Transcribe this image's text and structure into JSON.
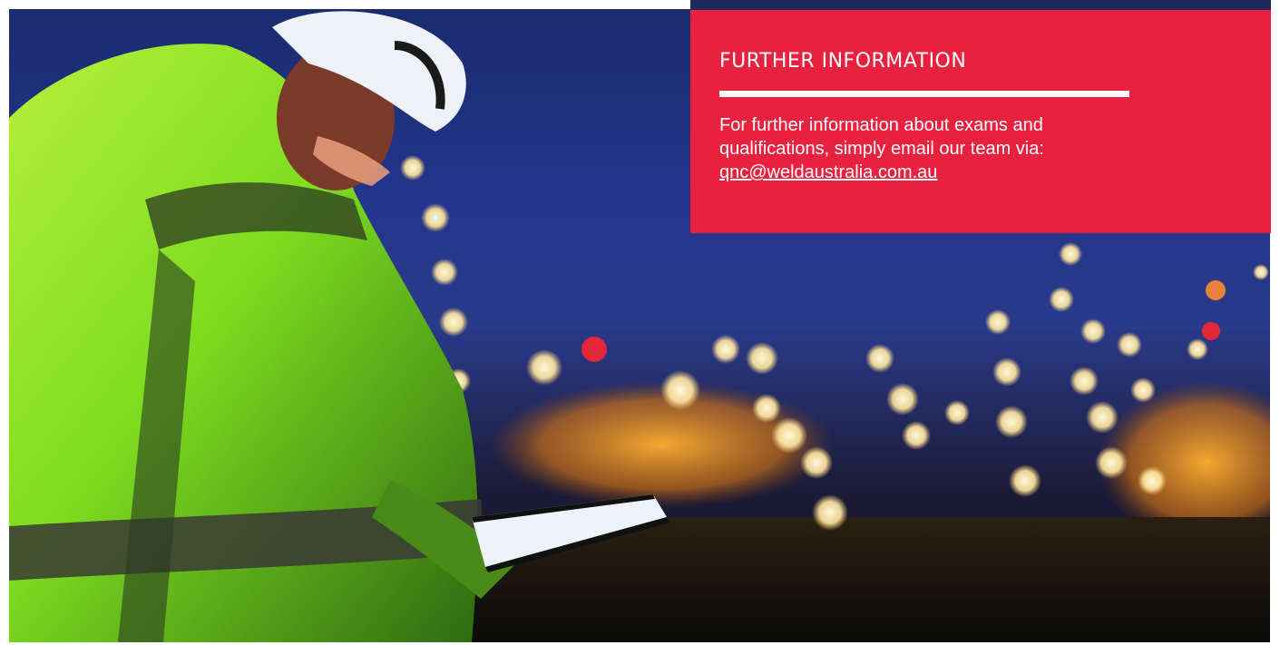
{
  "info_card": {
    "title": "FURTHER INFORMATION",
    "body_line_1": "For further information about exams and",
    "body_line_2": "qualifications, simply email our team via:",
    "email_link": "qnc@weldaustralia.com.au"
  },
  "colors": {
    "card_background": "#e8213e",
    "card_topbar": "#1e2a5c",
    "hi_vis_jacket": "#7ddc1f",
    "night_sky": "#24358c"
  },
  "hero": {
    "image_icon": "worker-with-tablet-photo"
  }
}
